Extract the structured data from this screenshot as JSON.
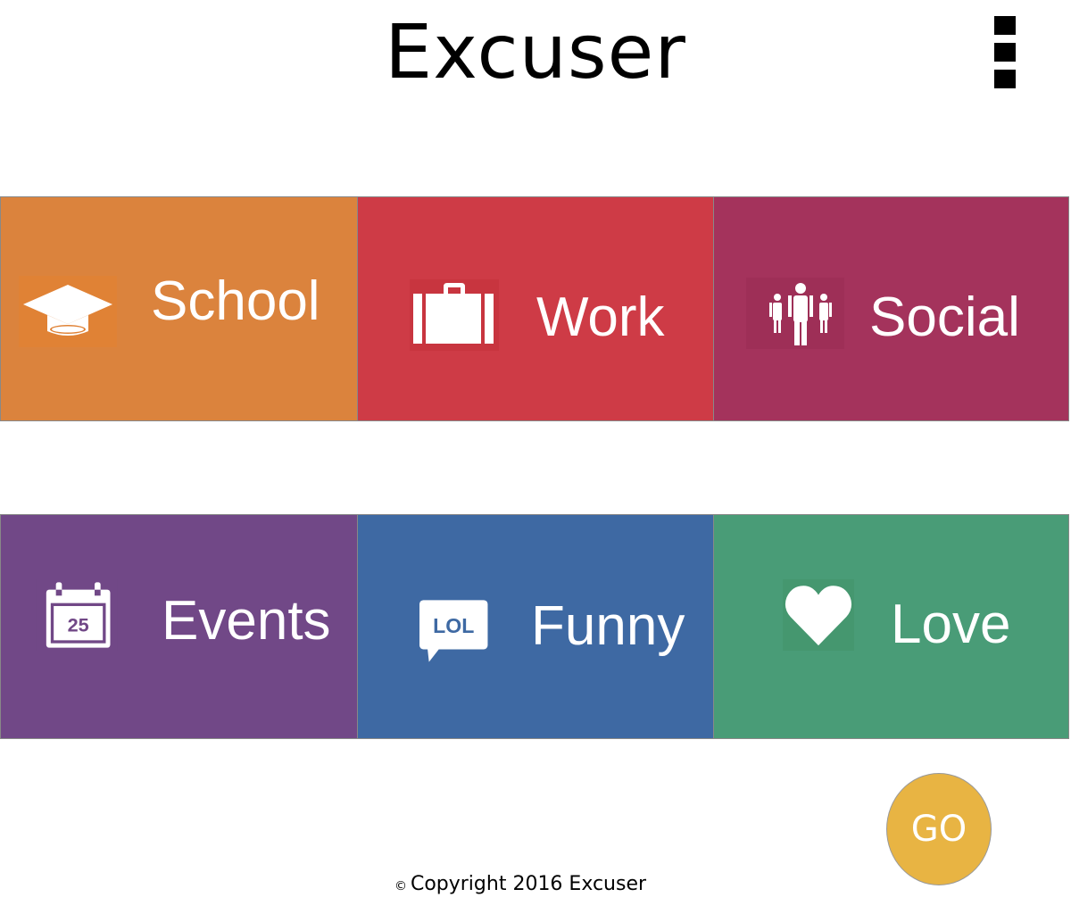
{
  "header": {
    "title": "Excuser",
    "menu_icon": "menu-icon"
  },
  "categories": [
    {
      "label": "School",
      "icon": "graduation-cap-icon",
      "color": "#DB833D"
    },
    {
      "label": "Work",
      "icon": "briefcase-icon",
      "color": "#CE3B46"
    },
    {
      "label": "Social",
      "icon": "people-icon",
      "color": "#A4335C"
    },
    {
      "label": "Events",
      "icon": "calendar-icon",
      "color": "#714887",
      "icon_text": "25"
    },
    {
      "label": "Funny",
      "icon": "lol-speech-bubble-icon",
      "color": "#3E69A3",
      "icon_text": "LOL"
    },
    {
      "label": "Love",
      "icon": "heart-icon",
      "color": "#499C77"
    }
  ],
  "go_button": {
    "label": "GO",
    "color": "#E8B443"
  },
  "footer": {
    "copyright_symbol": "©",
    "text": "Copyright 2016 Excuser"
  }
}
